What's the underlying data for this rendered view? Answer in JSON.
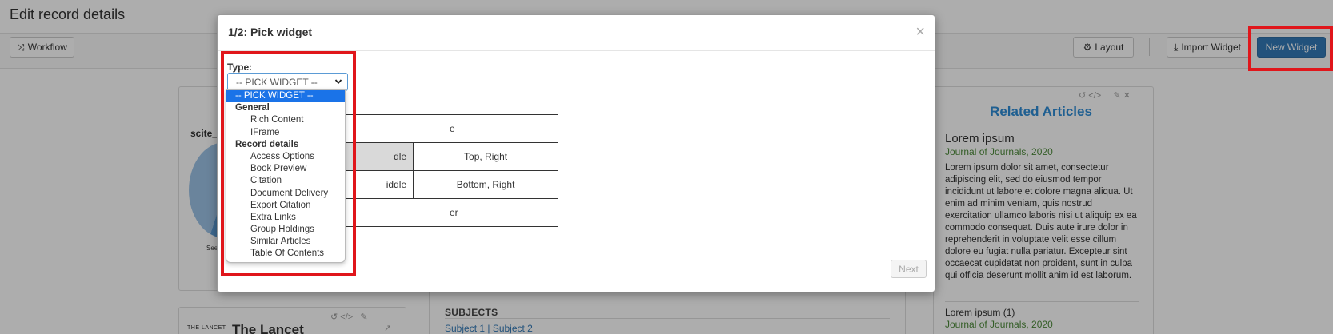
{
  "page": {
    "title": "Edit record details"
  },
  "toolbar": {
    "workflow_label": "Workflow",
    "layout_label": "Layout",
    "import_label": "Import Widget",
    "new_widget_label": "New Widget"
  },
  "background": {
    "scite_label": "scite_",
    "pie_caption": "See",
    "related": {
      "title": "Related Articles",
      "headline": "Lorem ipsum",
      "journal": "Journal of Journals, 2020",
      "body": "Lorem ipsum dolor sit amet, consectetur adipiscing elit, sed do eiusmod tempor incididunt ut labore et dolore magna aliqua. Ut enim ad minim veniam, quis nostrud exercitation ullamco laboris nisi ut aliquip ex ea commodo consequat. Duis aute irure dolor in reprehenderit in voluptate velit esse cillum dolore eu fugiat nulla pariatur. Excepteur sint occaecat cupidatat non proident, sunt in culpa qui officia deserunt mollit anim id est laborum.",
      "item_title": "Lorem ipsum (1)",
      "item_journal": "Journal of Journals, 2020"
    },
    "subjects": {
      "heading": "SUBJECTS",
      "links": "Subject 1 |  Subject 2"
    },
    "lancet": {
      "logo_text": "THE LANCET",
      "title": "The Lancet"
    }
  },
  "modal": {
    "title": "1/2: Pick widget",
    "close_glyph": "×",
    "type_label": "Type:",
    "select_value": "-- PICK WIDGET --",
    "next_label": "Next",
    "layout_table": {
      "r0": "e",
      "r1c1": "dle",
      "r1c2": "Top, Right",
      "r2c1": "iddle",
      "r2c2": "Bottom, Right",
      "r3": "er"
    }
  },
  "dropdown": {
    "selected": "-- PICK WIDGET --",
    "groups": [
      {
        "label": "General",
        "options": [
          "Rich Content",
          "IFrame"
        ]
      },
      {
        "label": "Record details",
        "options": [
          "Access Options",
          "Book Preview",
          "Citation",
          "Document Delivery",
          "Export Citation",
          "Extra Links",
          "Group Holdings",
          "Similar Articles",
          "Table Of Contents"
        ]
      }
    ]
  },
  "colors": {
    "accent": "#337ab7",
    "highlight": "#e0161b",
    "related_title": "#2f8dd6",
    "journal_green": "#4c8a39",
    "dropdown_selected": "#1a73e8"
  },
  "icons": {
    "workflow": "shuffle-icon",
    "layout": "gear-icon",
    "import": "download-icon",
    "close": "close-icon",
    "select": "chevron-down-icon"
  }
}
